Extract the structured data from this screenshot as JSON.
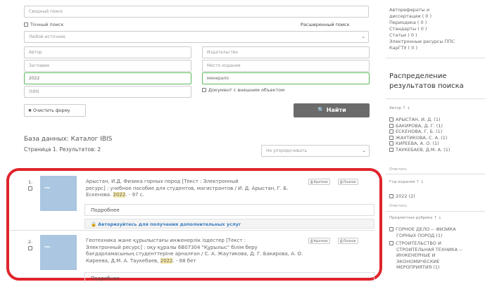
{
  "search": {
    "combined_placeholder": "Сводный поиск",
    "exact_label": "Точный поиск",
    "advanced_link": "Расширенный поиск",
    "source_select": "Любой источник",
    "author_placeholder": "Автор",
    "publisher_placeholder": "Издательство",
    "title_placeholder": "Заглавие",
    "place_placeholder": "Место издания",
    "year_value": "2022",
    "keyword_value": "минерало",
    "isbn_placeholder": "ISBN",
    "external_doc_label": "Документ с внешним объектом",
    "clear_button": "Очистить форму",
    "find_button": "Найти"
  },
  "results": {
    "database_label": "База данных: Каталог IBIS",
    "page_info": "Страница 1. Результатов: 2",
    "sort_select": "Не упорядочивать",
    "records": [
      {
        "num": "1.",
        "line1": "Арыстан, И.Д. Физика горных пород [Текст : Электронный",
        "line2": "ресурс] : учебное пособие для студентов, магистрантов / И. Д. Арыстан, Г. Б.",
        "line3a": "Ескенова.",
        "year": "2022",
        "line3b": ". - 97 с.",
        "brief": "Краткое",
        "full": "Полное",
        "more": "Подробнее",
        "auth": "Авторизуйтесь для получения дополнительных услуг"
      },
      {
        "num": "2.",
        "line1": "Геотехника және құрылыстағы инженерлік іздестер [Текст :",
        "line2": "Электронный ресурс] : оқу құралы 6В07304 \"Құрылыс\" білім беру",
        "line3": "бағдарламасының студенттеріне арналған / С. А. Жаутикова, Д. Г. Бакирова, А. О.",
        "line4a": "Киреева, Д.М. А. Таукебаев,",
        "year": "2022",
        "line4b": ". - 88 бет",
        "brief": "Краткое",
        "full": "Полное",
        "more": "Подробнее"
      }
    ]
  },
  "sidebar": {
    "types": [
      "Авторефераты и",
      "диссертации ( 0 )",
      "Периодика ( 0 )",
      "Стандарты ( 0 )",
      "Статьи ( 0 )",
      "Электронные ресурсы ППС",
      "КарГТУ ( 0 )"
    ],
    "dist_title_1": "Распределение",
    "dist_title_2": "результатов поиска",
    "author_header": "Автор ↑ ↓",
    "authors": [
      "АРЫСТАН, И. Д. (1)",
      "БАКИРОВА, Д. Г. (1)",
      "ЕСКЕНОВА, Г. Б. (1)",
      "ЖАУТИКОВА, С. А. (1)",
      "КИРЕЕВА, А. О. (1)",
      "ТАУКЕБАЕВ, Д.М. А. (1)"
    ],
    "clear_link": "Очистить",
    "year_header": "Год издания ↑ ↓",
    "years": [
      "2022 (2)"
    ],
    "clear_link2": "Очистить",
    "rubric_header": "Предметная рубрика ↑ ↓",
    "rubric1": [
      "ГОРНОЕ ДЕЛО -- ФИЗИКА",
      "ГОРНЫХ ПОРОД (1)"
    ],
    "rubric2": [
      "СТРОИТЕЛЬСТВО И",
      "СТРОИТЕЛЬНАЯ ТЕХНИКА --",
      "ИНЖЕНЕРНЫЕ И",
      "ЭКОНОМИЧЕСКИЕ",
      "МЕРОПРИЯТИЯ (1)"
    ]
  },
  "colors": {
    "highlight_border": "#e0242c",
    "find_button": "#6b6b6b",
    "link": "#3a7bbf"
  }
}
